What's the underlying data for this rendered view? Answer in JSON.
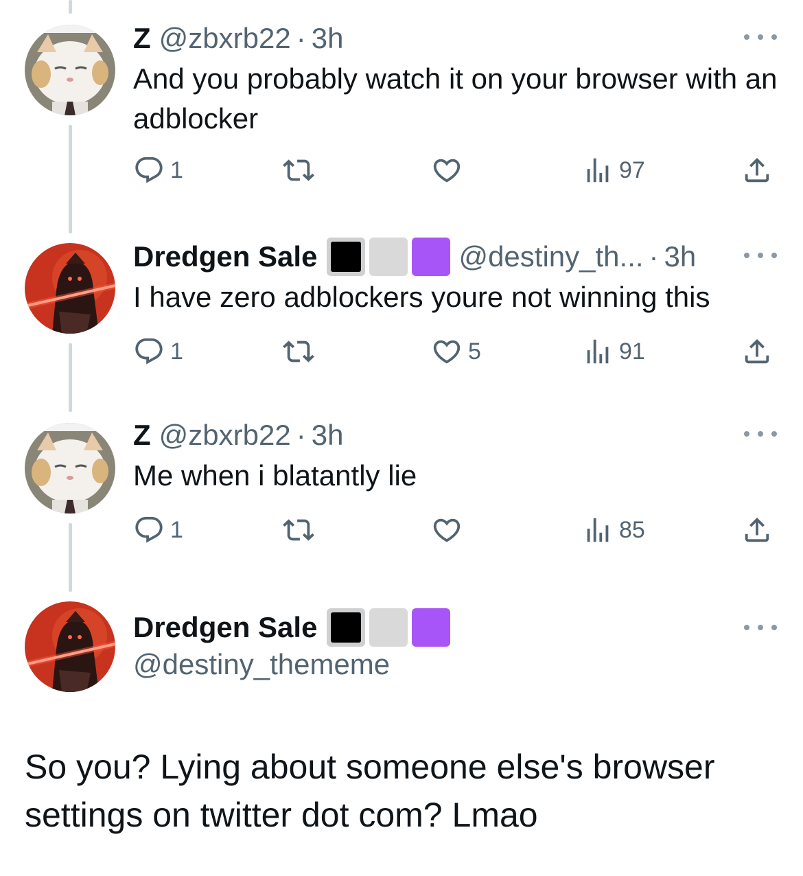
{
  "tweets": [
    {
      "name": "Z",
      "handle": "@zbxrb22",
      "separator": "·",
      "time": "3h",
      "text": "And you probably watch it on your browser with an adblocker",
      "avatar": "cat-avatar",
      "replies": "1",
      "retweets": "",
      "likes": "",
      "views": "97"
    },
    {
      "name": "Dredgen Sale",
      "flags": [
        "black-square",
        "white-square",
        "purple-square"
      ],
      "handle": "@destiny_th...",
      "separator": "·",
      "time": "3h",
      "text": "I have zero adblockers youre not winning this",
      "avatar": "red-warrior-avatar",
      "replies": "1",
      "retweets": "",
      "likes": "5",
      "views": "91"
    },
    {
      "name": "Z",
      "handle": "@zbxrb22",
      "separator": "·",
      "time": "3h",
      "text": "Me when i blatantly lie",
      "avatar": "cat-avatar",
      "replies": "1",
      "retweets": "",
      "likes": "",
      "views": "85"
    }
  ],
  "main_tweet": {
    "name": "Dredgen Sale",
    "flags": [
      "black-square",
      "white-square",
      "purple-square"
    ],
    "handle": "@destiny_thememe",
    "avatar": "red-warrior-avatar",
    "text": "So you? Lying about someone else's browser settings on twitter dot com? Lmao"
  },
  "colors": {
    "text": "#0f1419",
    "secondary": "#536471",
    "thread_line": "#cfd9de",
    "purple_square": "#a855f7"
  }
}
